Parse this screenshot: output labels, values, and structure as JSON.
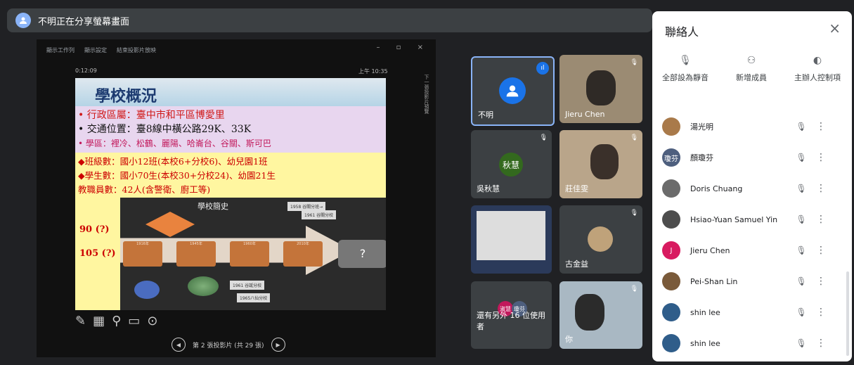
{
  "presenting": {
    "text": "不明正在分享螢幕畫面"
  },
  "share": {
    "toolbar": [
      "顯示工作列",
      "顯示設定",
      "結束投影片放映"
    ],
    "window_controls": "– ▫ ×",
    "timer": "0:12:09",
    "clock": "上午 10:35",
    "side_note": "下一張投影片預覽",
    "slide": {
      "title": "學校概況",
      "bullets": [
        "•  行政區屬：臺中市和平區博愛里",
        "•  交通位置：臺8線中橫公路29K、33K",
        "•  學區：裡冷、松鶴、麗陽、哈崙台、谷關、斯可巴"
      ],
      "yellow_lines": [
        "◆班級數：國小12班(本校6+分校6)、幼兒園1班",
        "◆學生數：國小70生(本校30+分校24)、幼園21生",
        "   教職員數：42人(含警衛、廚工等)"
      ],
      "label_90": "90 (?)",
      "label_105": "105 (?)",
      "history_title": "學校簡史",
      "history_boxes": [
        "1916年",
        "1945年",
        "1960年",
        "2010年"
      ],
      "history_question": "?",
      "history_notes": [
        "1958 谷關分班→",
        "1961 谷關分校",
        "1961 谷誕分校",
        "1965八仙分校"
      ]
    },
    "slide_counter": "第 2 張投影片 (共 29 張)"
  },
  "tiles": [
    {
      "name": "不明"
    },
    {
      "name": "Jieru Chen"
    },
    {
      "name": "吳秋慧",
      "initials": "秋慧"
    },
    {
      "name": "莊佳雯"
    },
    {
      "name": ""
    },
    {
      "name": "古金益"
    },
    {
      "name": "還有另外 16 位使用者",
      "initials_a": "淑慧",
      "initials_b": "瓊芬"
    },
    {
      "name": "你"
    }
  ],
  "panel": {
    "title": "聯絡人",
    "close": "×",
    "actions": [
      "全部設為靜音",
      "新增成員",
      "主辦人控制項"
    ],
    "people": [
      {
        "name": "湯光明",
        "color": "#a97a4a"
      },
      {
        "name": "顏瓊芬",
        "color": "#4e5f7e",
        "initials": "瓊芬"
      },
      {
        "name": "Doris Chuang",
        "color": "#6b6b6b"
      },
      {
        "name": "Hsiao-Yuan Samuel Yin",
        "color": "#4d4d4d"
      },
      {
        "name": "Jieru Chen",
        "color": "#d81b60",
        "initials": "J"
      },
      {
        "name": "Pei-Shan Lin",
        "color": "#7a5a3a"
      },
      {
        "name": "shin lee",
        "color": "#2f5d8a"
      },
      {
        "name": "shin lee",
        "color": "#2f5d8a"
      }
    ]
  }
}
